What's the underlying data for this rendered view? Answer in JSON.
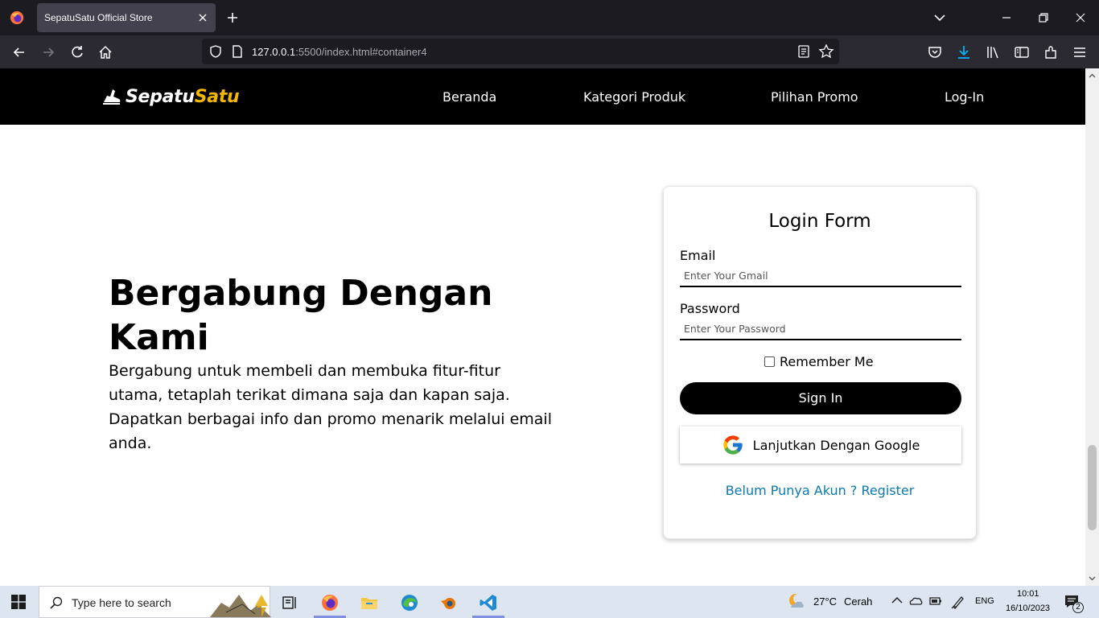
{
  "browser": {
    "tab_title": "SepatuSatu Official Store",
    "url_host": "127.0.0.1",
    "url_rest": ":5500/index.html#container4"
  },
  "site": {
    "brand_white": "Sepatu",
    "brand_yellow": "Satu",
    "menu": [
      "Beranda",
      "Kategori Produk",
      "Pilihan Promo",
      "Log-In"
    ]
  },
  "hero": {
    "title_line1": "Bergabung Dengan",
    "title_line2": "Kami",
    "description": "Bergabung untuk membeli dan membuka fitur-fitur utama, tetaplah terikat dimana saja dan kapan saja. Dapatkan berbagai info dan promo menarik melalui email anda."
  },
  "login": {
    "title": "Login Form",
    "email_label": "Email",
    "email_placeholder": "Enter Your Gmail",
    "password_label": "Password",
    "password_placeholder": "Enter Your Password",
    "remember_label": "Remember Me",
    "signin_label": "Sign In",
    "google_label": "Lanjutkan Dengan Google",
    "register_label": "Belum Punya Akun ? Register"
  },
  "taskbar": {
    "search_placeholder": "Type here to search",
    "weather_temp": "27°C",
    "weather_desc": "Cerah",
    "language": "ENG",
    "time": "10:01",
    "date": "16/10/2023",
    "notification_count": "2"
  },
  "colors": {
    "brand_yellow": "#f5b800",
    "link_blue": "#0a7ab0",
    "header_black": "#000000"
  }
}
